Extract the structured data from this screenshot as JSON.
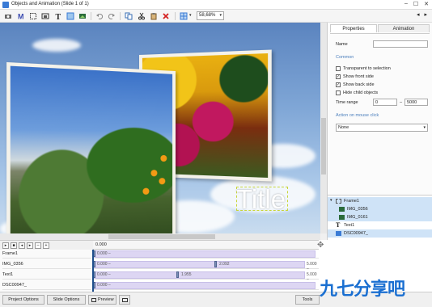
{
  "window": {
    "title": "Objects and Animation (Slide 1 of 1)"
  },
  "toolbar": {
    "zoom": "58,68%"
  },
  "canvas": {
    "title_text": "Title"
  },
  "properties": {
    "tabs": [
      "Properties",
      "Animation"
    ],
    "name_label": "Name",
    "name_value": "",
    "common_label": "Common",
    "checks": [
      {
        "label": "Transparent to selection",
        "checked": false
      },
      {
        "label": "Show front side",
        "checked": true
      },
      {
        "label": "Show back side",
        "checked": true
      },
      {
        "label": "Hide child objects",
        "checked": false
      }
    ],
    "time_range_label": "Time range",
    "time_from": "0",
    "time_sep": "–",
    "time_to": "5000",
    "action_label": "Action on mouse click",
    "action_value": "None"
  },
  "object_tree": [
    "Frame1",
    "IMG_0356",
    "IMG_0161",
    "Text1",
    "DSC00947_"
  ],
  "timeline": {
    "ruler_label": "0.000",
    "tracks": [
      {
        "name": "Frame1",
        "keys": [
          "0.000 –"
        ]
      },
      {
        "name": "IMG_0356",
        "keys": [
          "0.000 –",
          "2.092",
          "5.000 –"
        ]
      },
      {
        "name": "Text1",
        "keys": [
          "0.000 –",
          "1.955",
          "5.000 –"
        ]
      },
      {
        "name": "DSC00947_",
        "keys": [
          "0.000 –"
        ]
      }
    ]
  },
  "bottom": {
    "project_options": "Project Options",
    "slide_options": "Slide Options",
    "preview": "Preview",
    "tools": "Tools"
  },
  "watermark": "九七分享吧",
  "colors": {
    "accent": "#4a7ebc",
    "selection": "#cfe3f7",
    "timeline_bar": "#ddd6f3"
  },
  "icons": [
    "add-image-icon",
    "add-text-icon",
    "add-frame-icon",
    "undo-icon",
    "redo-icon",
    "copy-icon",
    "cut-icon",
    "paste-icon",
    "delete-icon",
    "grid-icon"
  ]
}
